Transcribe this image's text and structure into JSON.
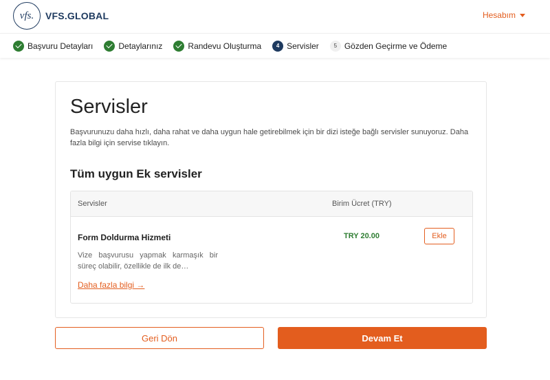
{
  "header": {
    "logo_mark": "vfs.",
    "logo_text": "VFS.GLOBAL",
    "account_label": "Hesabım"
  },
  "stepper": {
    "steps": [
      {
        "label": "Başvuru Detayları",
        "state": "done"
      },
      {
        "label": "Detaylarınız",
        "state": "done"
      },
      {
        "label": "Randevu Oluşturma",
        "state": "done"
      },
      {
        "number": "4",
        "label": "Servisler",
        "state": "current"
      },
      {
        "number": "5",
        "label": "Gözden Geçirme ve Ödeme",
        "state": "todo"
      }
    ]
  },
  "main": {
    "title": "Servisler",
    "intro": "Başvurunuzu daha hızlı, daha rahat ve daha uygun hale getirebilmek için bir dizi isteğe bağlı servisler sunuyoruz. Daha fazla bilgi için servise tıklayın.",
    "subtitle": "Tüm uygun Ek servisler",
    "table": {
      "headers": {
        "service": "Servisler",
        "price": "Birim Ücret (TRY)"
      },
      "rows": [
        {
          "name": "Form Doldurma Hizmeti",
          "description": "Vize başvurusu yapmak karmaşık bir süreç olabilir, özellikle de ilk de…",
          "more_link": "Daha fazla bilgi →",
          "price": "TRY 20.00",
          "add_label": "Ekle"
        }
      ]
    }
  },
  "footer": {
    "back_label": "Geri Dön",
    "next_label": "Devam Et"
  },
  "colors": {
    "accent": "#e35d1e",
    "brand": "#1e3a5f",
    "success": "#2e7d32"
  }
}
